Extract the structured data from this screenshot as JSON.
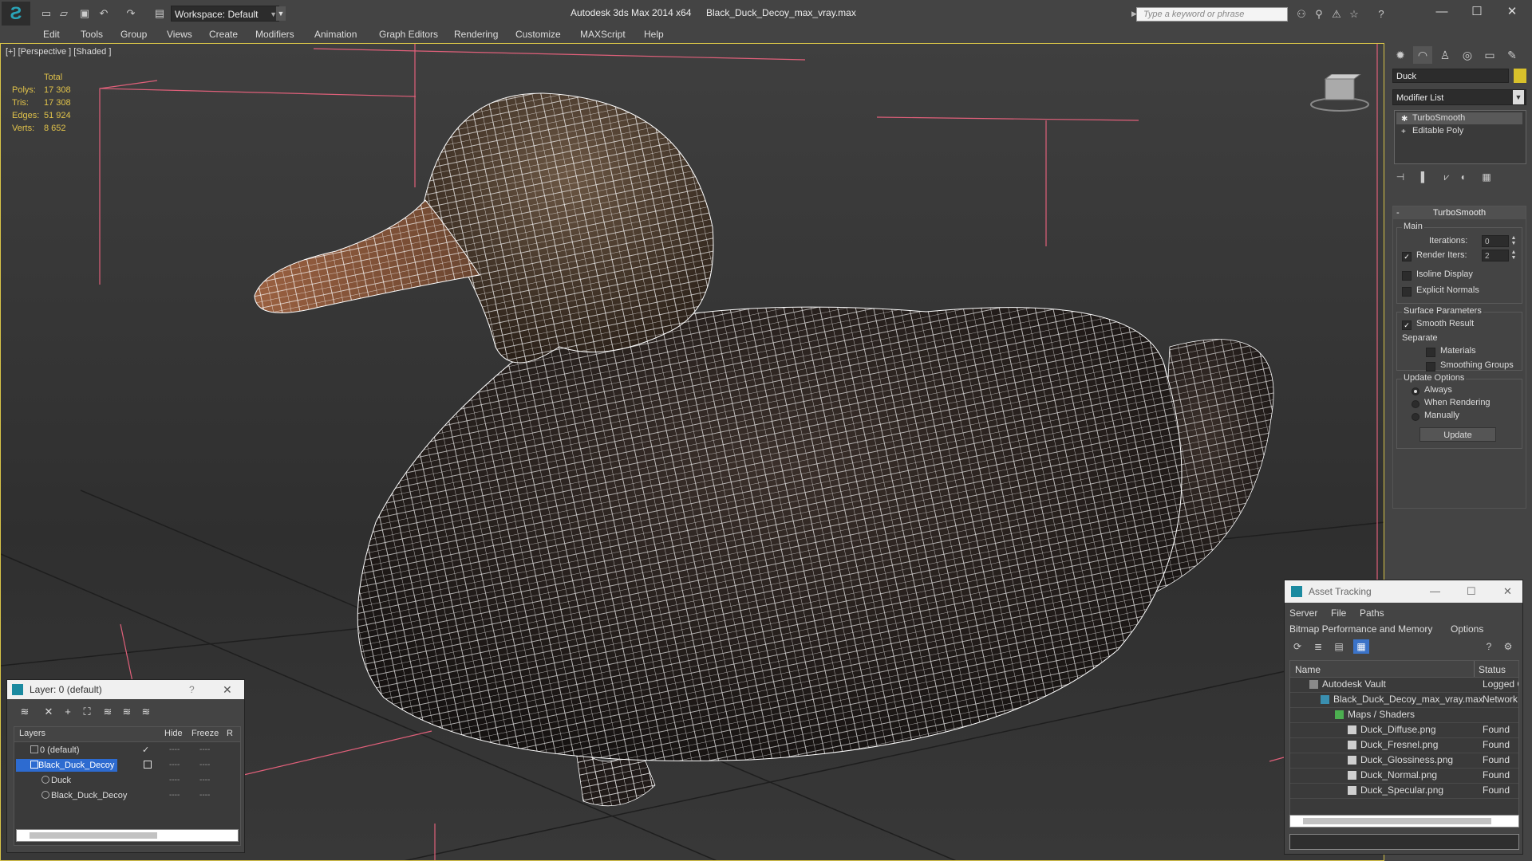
{
  "titlebar": {
    "app_title": "Autodesk 3ds Max  2014 x64",
    "file_title": "Black_Duck_Decoy_max_vray.max",
    "workspace": "Workspace: Default",
    "search_placeholder": "Type a keyword or phrase",
    "icons": [
      "new-file-icon",
      "open-file-icon",
      "save-icon",
      "undo-icon",
      "redo-icon",
      "project-folder-icon"
    ],
    "right_icons": [
      "binoculars-icon",
      "search-icon",
      "communication-icon",
      "favorites-icon",
      "help-icon"
    ]
  },
  "menu": [
    "Edit",
    "Tools",
    "Group",
    "Views",
    "Create",
    "Modifiers",
    "Animation",
    "Graph Editors",
    "Rendering",
    "Customize",
    "MAXScript",
    "Help"
  ],
  "viewport": {
    "label": "[+] [Perspective ] [Shaded ]",
    "stats": {
      "total_label": "Total",
      "rows": [
        {
          "k": "Polys:",
          "v": "17 308"
        },
        {
          "k": "Tris:",
          "v": "17 308"
        },
        {
          "k": "Edges:",
          "v": "51 924"
        },
        {
          "k": "Verts:",
          "v": "8 652"
        }
      ]
    },
    "colors": {
      "wire": "#ffffff",
      "body": "#2a2220",
      "head": "#5a4838",
      "beak": "#8a5232",
      "grid": "#1e1e1e",
      "light_lines": "#e0607a"
    }
  },
  "command_panel": {
    "object_name": "Duck",
    "object_color": "#d8c12b",
    "modifier_list": "Modifier List",
    "stack": [
      "TurboSmooth",
      "Editable Poly"
    ],
    "rollout_title": "TurboSmooth",
    "main": {
      "title": "Main",
      "iterations_label": "Iterations:",
      "iterations_value": "0",
      "render_iters_label": "Render Iters:",
      "render_iters_value": "2",
      "render_iters_checked": true,
      "isoline_label": "Isoline Display",
      "explicit_label": "Explicit Normals"
    },
    "surface": {
      "title": "Surface Parameters",
      "smooth_label": "Smooth Result",
      "smooth_checked": true,
      "separate_label": "Separate",
      "materials_label": "Materials",
      "smoothing_label": "Smoothing Groups"
    },
    "update": {
      "title": "Update Options",
      "always": "Always",
      "when_rendering": "When Rendering",
      "manually": "Manually",
      "selected": "Always",
      "button": "Update"
    }
  },
  "layer_window": {
    "title": "Layer: 0 (default)",
    "help": "?",
    "columns": {
      "layers": "Layers",
      "hide": "Hide",
      "freeze": "Freeze",
      "r": "R"
    },
    "rows": [
      {
        "name": "0 (default)",
        "indent": 0,
        "selected": false
      },
      {
        "name": "Black_Duck_Decoy",
        "indent": 0,
        "selected": true
      },
      {
        "name": "Duck",
        "indent": 1,
        "selected": false
      },
      {
        "name": "Black_Duck_Decoy",
        "indent": 1,
        "selected": false
      }
    ],
    "dash": "----"
  },
  "asset_window": {
    "title": "Asset Tracking",
    "menu": [
      "Server",
      "File",
      "Paths",
      "Bitmap Performance and Memory",
      "Options"
    ],
    "columns": {
      "name": "Name",
      "status": "Status"
    },
    "rows": [
      {
        "name": "Autodesk Vault",
        "status": "Logged O",
        "indent": 1
      },
      {
        "name": "Black_Duck_Decoy_max_vray.max",
        "status": "Network",
        "indent": 2
      },
      {
        "name": "Maps / Shaders",
        "status": "",
        "indent": 3
      },
      {
        "name": "Duck_Diffuse.png",
        "status": "Found",
        "indent": 4
      },
      {
        "name": "Duck_Fresnel.png",
        "status": "Found",
        "indent": 4
      },
      {
        "name": "Duck_Glossiness.png",
        "status": "Found",
        "indent": 4
      },
      {
        "name": "Duck_Normal.png",
        "status": "Found",
        "indent": 4
      },
      {
        "name": "Duck_Specular.png",
        "status": "Found",
        "indent": 4
      }
    ]
  }
}
